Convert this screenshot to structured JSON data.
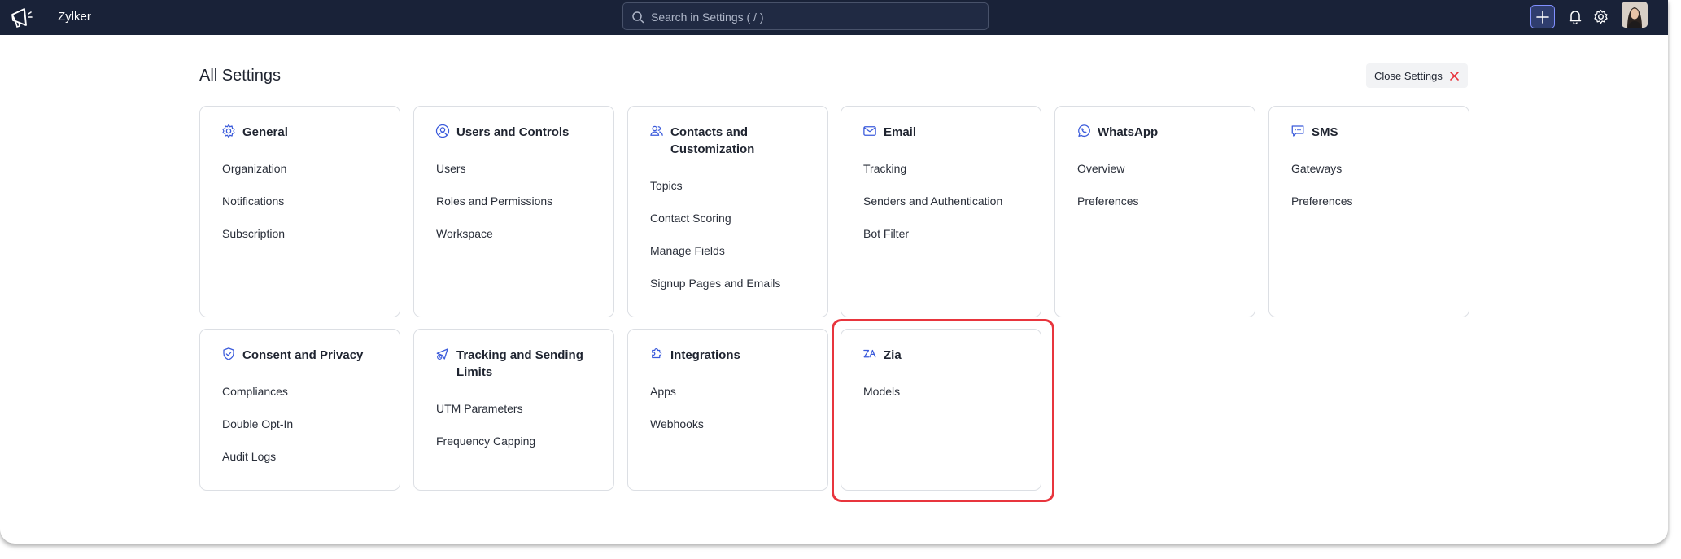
{
  "app": {
    "org_name": "Zylker",
    "search_placeholder": "Search in Settings ( / )"
  },
  "page": {
    "title": "All Settings",
    "close_label": "Close Settings"
  },
  "colors": {
    "topbar": "#192238",
    "accent": "#3b5bdb",
    "highlight": "#e8353d"
  },
  "cards": [
    {
      "id": "general",
      "icon": "gear-icon",
      "title": "General",
      "items": [
        "Organization",
        "Notifications",
        "Subscription"
      ]
    },
    {
      "id": "users",
      "icon": "user-circle-icon",
      "title": "Users and Controls",
      "items": [
        "Users",
        "Roles and Permissions",
        "Workspace"
      ]
    },
    {
      "id": "contacts",
      "icon": "contacts-icon",
      "title": "Contacts and Customization",
      "items": [
        "Topics",
        "Contact Scoring",
        "Manage Fields",
        "Signup Pages and Emails"
      ]
    },
    {
      "id": "email",
      "icon": "envelope-icon",
      "title": "Email",
      "items": [
        "Tracking",
        "Senders and Authentication",
        "Bot Filter"
      ]
    },
    {
      "id": "whatsapp",
      "icon": "whatsapp-icon",
      "title": "WhatsApp",
      "items": [
        "Overview",
        "Preferences"
      ]
    },
    {
      "id": "sms",
      "icon": "chat-bubble-icon",
      "title": "SMS",
      "items": [
        "Gateways",
        "Preferences"
      ]
    },
    {
      "id": "consent",
      "icon": "shield-check-icon",
      "title": "Consent and Privacy",
      "items": [
        "Compliances",
        "Double Opt-In",
        "Audit Logs"
      ]
    },
    {
      "id": "tracking",
      "icon": "send-limit-icon",
      "title": "Tracking and Sending Limits",
      "items": [
        "UTM Parameters",
        "Frequency Capping"
      ]
    },
    {
      "id": "integrations",
      "icon": "puzzle-icon",
      "title": "Integrations",
      "items": [
        "Apps",
        "Webhooks"
      ]
    },
    {
      "id": "zia",
      "icon": "zia-icon",
      "title": "Zia",
      "items": [
        "Models"
      ]
    }
  ]
}
